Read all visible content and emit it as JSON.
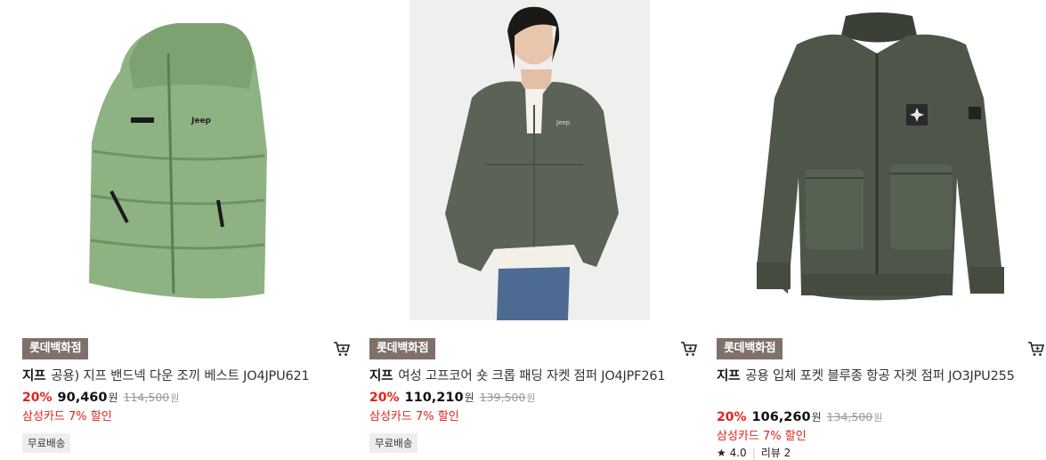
{
  "products": [
    {
      "image": "green-padded-vest",
      "store": "롯데백화점",
      "brand": "지프",
      "name": "공용) 지프 밴드넥 다운 조끼 베스트 JO4JPU621",
      "discount_rate": "20%",
      "sale_price": "90,460",
      "currency": "원",
      "original_price": "114,500",
      "card_discount": "삼성카드 7% 할인",
      "shipping": "무료배송"
    },
    {
      "image": "model-cropped-padded-jacket",
      "store": "롯데백화점",
      "brand": "지프",
      "name": "여성 고프코어 숏 크롭 패딩 자켓 점퍼 JO4JPF261",
      "discount_rate": "20%",
      "sale_price": "110,210",
      "currency": "원",
      "original_price": "139,500",
      "card_discount": "삼성카드 7% 할인",
      "shipping": "무료배송"
    },
    {
      "image": "olive-bomber-jacket",
      "store": "롯데백화점",
      "brand": "지프",
      "name": "공용 입체 포켓 블루종 항공 자켓 점퍼 JO3JPU255",
      "discount_rate": "20%",
      "sale_price": "106,260",
      "currency": "원",
      "original_price": "134,500",
      "card_discount": "삼성카드 7% 할인",
      "rating": "4.0",
      "review_label": "리뷰 2"
    }
  ],
  "icons": {
    "cart": "cart-icon",
    "star": "star-icon"
  },
  "colors": {
    "discount": "#e2231a",
    "store_badge": "#80706a"
  }
}
